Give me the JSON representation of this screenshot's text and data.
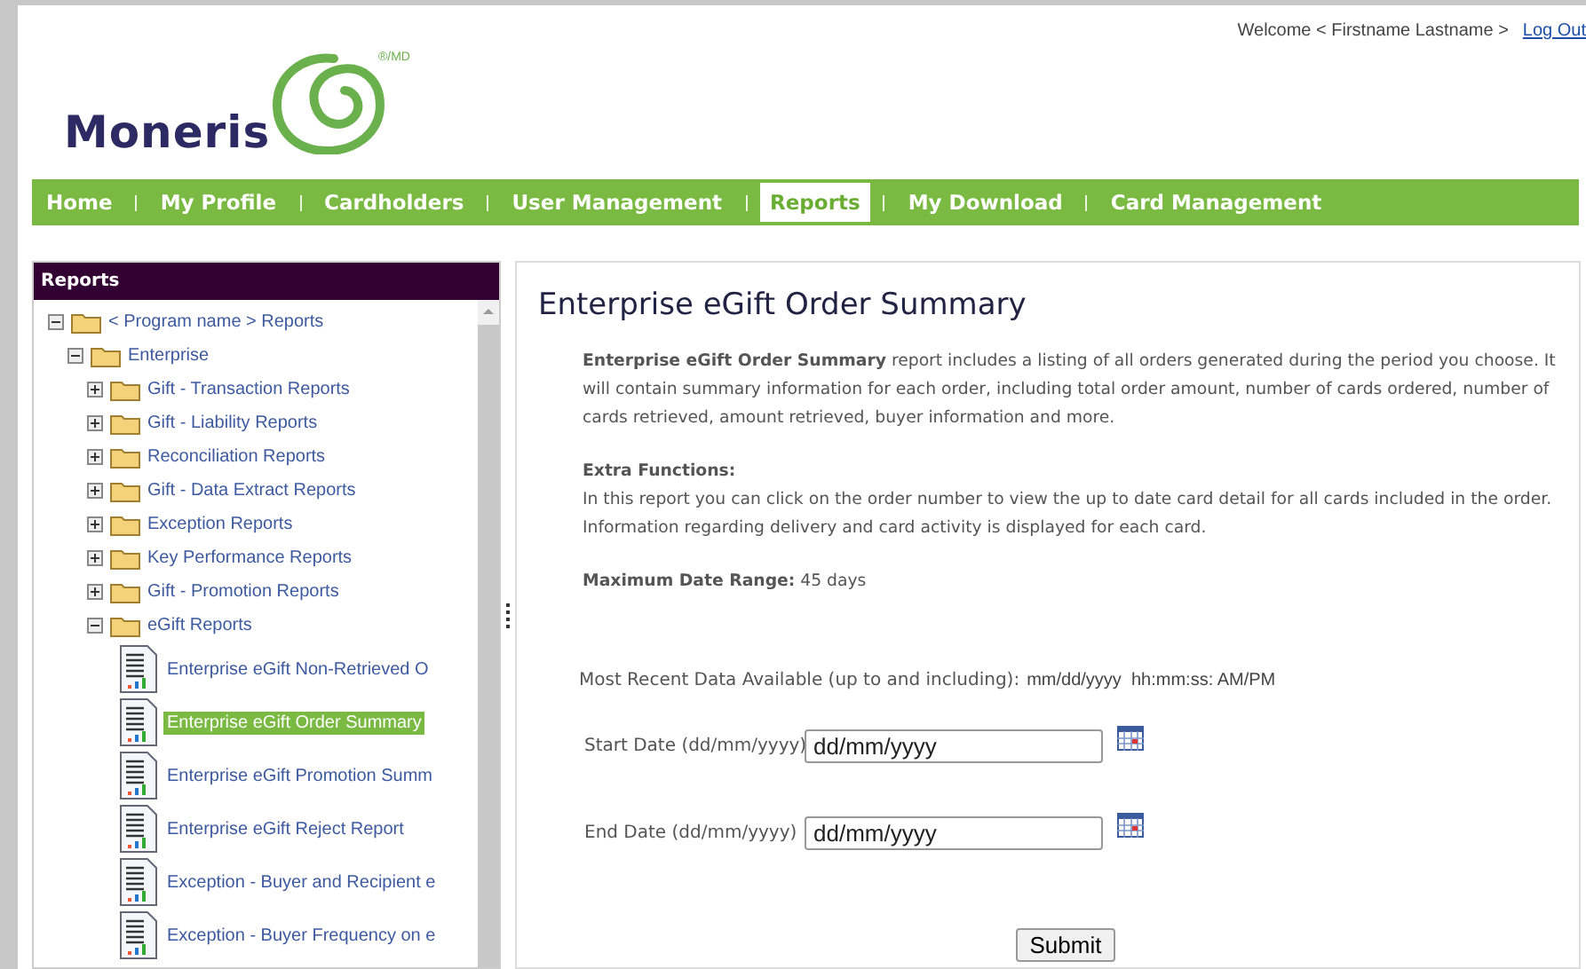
{
  "header": {
    "welcome": "Welcome < Firstname Lastname >",
    "logout": "Log Out",
    "logo": {
      "name": "Moneris",
      "mark": "®/MD"
    }
  },
  "nav": [
    {
      "label": "Home",
      "selected": false
    },
    {
      "label": "My Profile",
      "selected": false
    },
    {
      "label": "Cardholders",
      "selected": false
    },
    {
      "label": "User Management",
      "selected": false
    },
    {
      "label": "Reports",
      "selected": true
    },
    {
      "label": "My Download",
      "selected": false
    },
    {
      "label": "Card Management",
      "selected": false
    }
  ],
  "sidebar": {
    "title": "Reports",
    "tree": [
      {
        "kind": "folder",
        "label": "< Program name > Reports",
        "expanded": true,
        "children": [
          {
            "kind": "folder",
            "label": "Enterprise",
            "expanded": true,
            "children": [
              {
                "kind": "folder",
                "label": "Gift - Transaction Reports",
                "expanded": false
              },
              {
                "kind": "folder",
                "label": "Gift - Liability Reports",
                "expanded": false
              },
              {
                "kind": "folder",
                "label": "Reconciliation Reports",
                "expanded": false
              },
              {
                "kind": "folder",
                "label": "Gift - Data Extract Reports",
                "expanded": false
              },
              {
                "kind": "folder",
                "label": "Exception Reports",
                "expanded": false
              },
              {
                "kind": "folder",
                "label": "Key Performance Reports",
                "expanded": false
              },
              {
                "kind": "folder",
                "label": "Gift - Promotion Reports",
                "expanded": false
              },
              {
                "kind": "folder",
                "label": "eGift Reports",
                "expanded": true,
                "children": [
                  {
                    "kind": "report",
                    "label": "Enterprise eGift Non-Retrieved O",
                    "selected": false
                  },
                  {
                    "kind": "report",
                    "label": "Enterprise eGift Order Summary",
                    "selected": true
                  },
                  {
                    "kind": "report",
                    "label": "Enterprise eGift Promotion Summ",
                    "selected": false
                  },
                  {
                    "kind": "report",
                    "label": "Enterprise eGift Reject Report",
                    "selected": false
                  },
                  {
                    "kind": "report",
                    "label": "Exception - Buyer and Recipient e",
                    "selected": false
                  },
                  {
                    "kind": "report",
                    "label": "Exception - Buyer Frequency on e",
                    "selected": false
                  }
                ]
              }
            ]
          }
        ]
      }
    ]
  },
  "main": {
    "title": "Enterprise eGift Order Summary",
    "description": "**Enterprise eGift Order Summary** report includes a listing of all orders generated during the period you choose. It will contain summary information for each order, including total order amount, number of cards ordered, number of cards retrieved, amount retrieved, buyer information and more.",
    "extra_heading": "Extra Functions:",
    "extra_text": "In this report you can click on the order number to view the up to date card detail for all cards included in the order. Information regarding delivery and card activity is displayed for each card.",
    "max_range": "**Maximum Date Range:** 45 days",
    "recent_label": "Most Recent Data Available (up to and including):",
    "recent_value": "mm/dd/yyyy  hh:mm:ss: AM/PM",
    "fields": [
      {
        "label": "Start Date (dd/mm/yyyy)",
        "value": "dd/mm/yyyy"
      },
      {
        "label": "End Date (dd/mm/yyyy)",
        "value": "dd/mm/yyyy"
      }
    ],
    "submit": "Submit"
  }
}
